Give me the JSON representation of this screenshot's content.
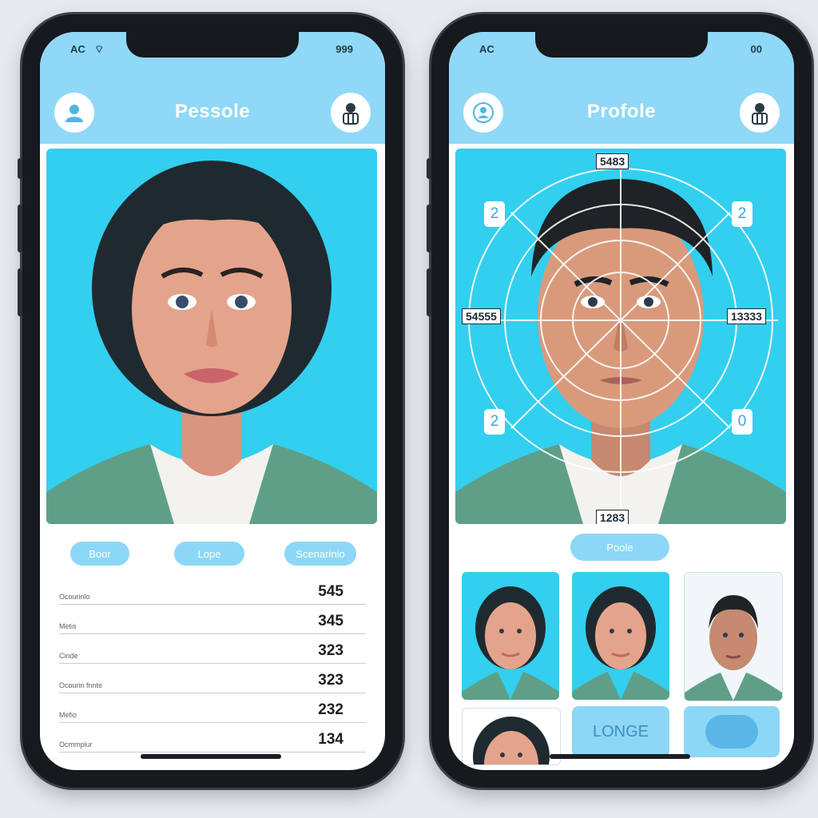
{
  "left": {
    "status": {
      "left": "AC",
      "right": "999"
    },
    "title": "Pessole",
    "pills": [
      "Boor",
      "Lope",
      "Scenarinio"
    ],
    "stats": [
      {
        "label": "Ocourinlo",
        "value": "545"
      },
      {
        "label": "Metis",
        "value": "345"
      },
      {
        "label": "Cinde",
        "value": "323"
      },
      {
        "label": "Ocourin fnnte",
        "value": "323"
      },
      {
        "label": "Mefio",
        "value": "232"
      },
      {
        "label": "Ocmmplur",
        "value": "134"
      }
    ]
  },
  "right": {
    "status": {
      "left": "AC",
      "right": "00"
    },
    "title": "Profole",
    "scan_labels": {
      "top": "5483",
      "left": "54555",
      "right": "13333",
      "bottom": "1283"
    },
    "scan_numbers": {
      "top_left": "2",
      "top_right": "2",
      "bottom_left": "2",
      "bottom_right": "0"
    },
    "scan_pill": "Poole",
    "tile_label": "LONGE"
  },
  "colors": {
    "header": "#8fd8f7",
    "photo_bg": "#33cfee",
    "pill": "#8dd7f6",
    "accent": "#3da7d6"
  }
}
